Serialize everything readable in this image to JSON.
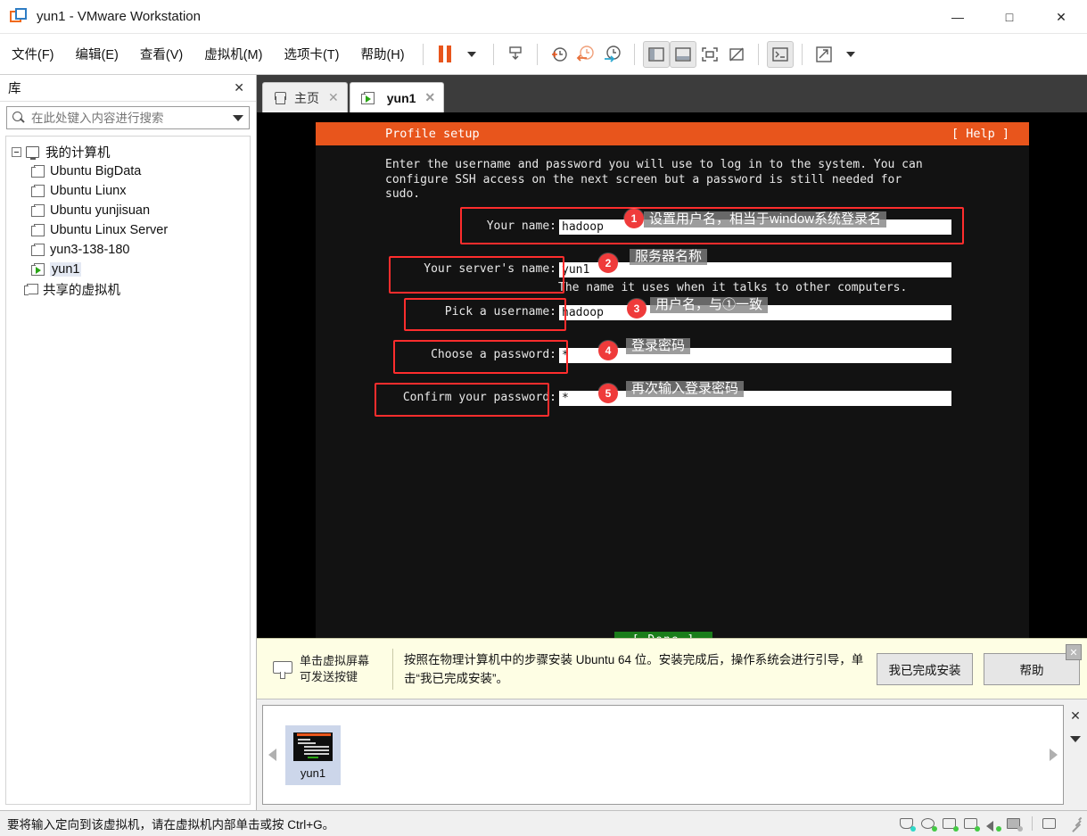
{
  "window": {
    "title": "yun1 - VMware Workstation",
    "logo_icon": "vmware-logo-icon",
    "minimize_label": "—",
    "maximize_label": "□",
    "close_label": "✕"
  },
  "menubar": {
    "items": [
      {
        "label": "文件(F)",
        "name": "menu-file"
      },
      {
        "label": "编辑(E)",
        "name": "menu-edit"
      },
      {
        "label": "查看(V)",
        "name": "menu-view"
      },
      {
        "label": "虚拟机(M)",
        "name": "menu-vm"
      },
      {
        "label": "选项卡(T)",
        "name": "menu-tabs"
      },
      {
        "label": "帮助(H)",
        "name": "menu-help"
      }
    ],
    "toolbar_icons": [
      "pause-icon",
      "dropdown-caret-icon",
      "send-to-back-icon",
      "take-snapshot-icon",
      "revert-snapshot-icon",
      "manage-snapshots-icon",
      "show-library-icon",
      "show-thumbnails-icon",
      "full-screen-icon",
      "unity-mode-icon",
      "console-view-icon",
      "stretch-view-icon",
      "view-caret-icon"
    ]
  },
  "sidebar": {
    "title": "库",
    "close_label": "✕",
    "search": {
      "placeholder": "在此处键入内容进行搜索",
      "value": ""
    },
    "tree": {
      "root": "我的计算机",
      "items": [
        "Ubuntu BigData",
        "Ubuntu Liunx",
        "Ubuntu  yunjisuan",
        "Ubuntu Linux Server",
        "yun3-138-180",
        "yun1"
      ],
      "selected": "yun1",
      "shared": "共享的虚拟机"
    }
  },
  "tabs": [
    {
      "label": "主页",
      "icon": "home-icon",
      "active": false,
      "close_label": "✕"
    },
    {
      "label": "yun1",
      "icon": "vm-running-icon",
      "active": true,
      "close_label": "✕"
    }
  ],
  "terminal": {
    "header_title": "Profile setup",
    "header_help": "[ Help ]",
    "intro": "Enter the username and password you will use to log in to the system. You can\nconfigure SSH access on the next screen but a password is still needed for\nsudo.",
    "fields": [
      {
        "label": "Your name:",
        "value": "hadoop",
        "badge": "1",
        "note": "设置用户名，相当于window系统登录名",
        "helper": ""
      },
      {
        "label": "Your server's name:",
        "value": "yun1",
        "badge": "2",
        "note": "服务器名称",
        "helper": "The name it uses when it talks to other computers."
      },
      {
        "label": "Pick a username:",
        "value": "hadoop",
        "badge": "3",
        "note": "用户名，与①一致",
        "helper": ""
      },
      {
        "label": "Choose a password:",
        "value": "*",
        "badge": "4",
        "note": "登录密码",
        "helper": ""
      },
      {
        "label": "Confirm your password:",
        "value": "*",
        "badge": "5",
        "note": "再次输入登录密码",
        "helper": ""
      }
    ],
    "done_label": "[ Done          ]",
    "colors": {
      "header_bg": "#e8551c",
      "screen_bg": "#121212",
      "done_bg": "#1a7d1a",
      "annotation": "#ff2d2d"
    }
  },
  "hintbar": {
    "keyboard_icon": "keyboard-icon",
    "click_hint": "单击虚拟屏幕\n可发送按键",
    "message": "按照在物理计算机中的步骤安装 Ubuntu 64 位。安装完成后，操作系统会进行引导，单击“我已完成安装”。",
    "primary_button": "我已完成安装",
    "secondary_button": "帮助",
    "close_label": "✕"
  },
  "thumbnails": {
    "items": [
      {
        "label": "yun1",
        "selected": true
      }
    ],
    "left_arrow": "prev-arrow-icon",
    "right_arrow": "next-arrow-icon",
    "close_label": "✕",
    "collapse_icon": "collapse-caret-icon"
  },
  "statusbar": {
    "message": "要将输入定向到该虚拟机，请在虚拟机内部单击或按 Ctrl+G。",
    "device_icons": [
      "hard-disk-icon",
      "cd-dvd-icon",
      "network-adapter-icon",
      "printer-icon",
      "sound-card-icon",
      "usb-device-icon",
      "floppy-icon"
    ]
  }
}
